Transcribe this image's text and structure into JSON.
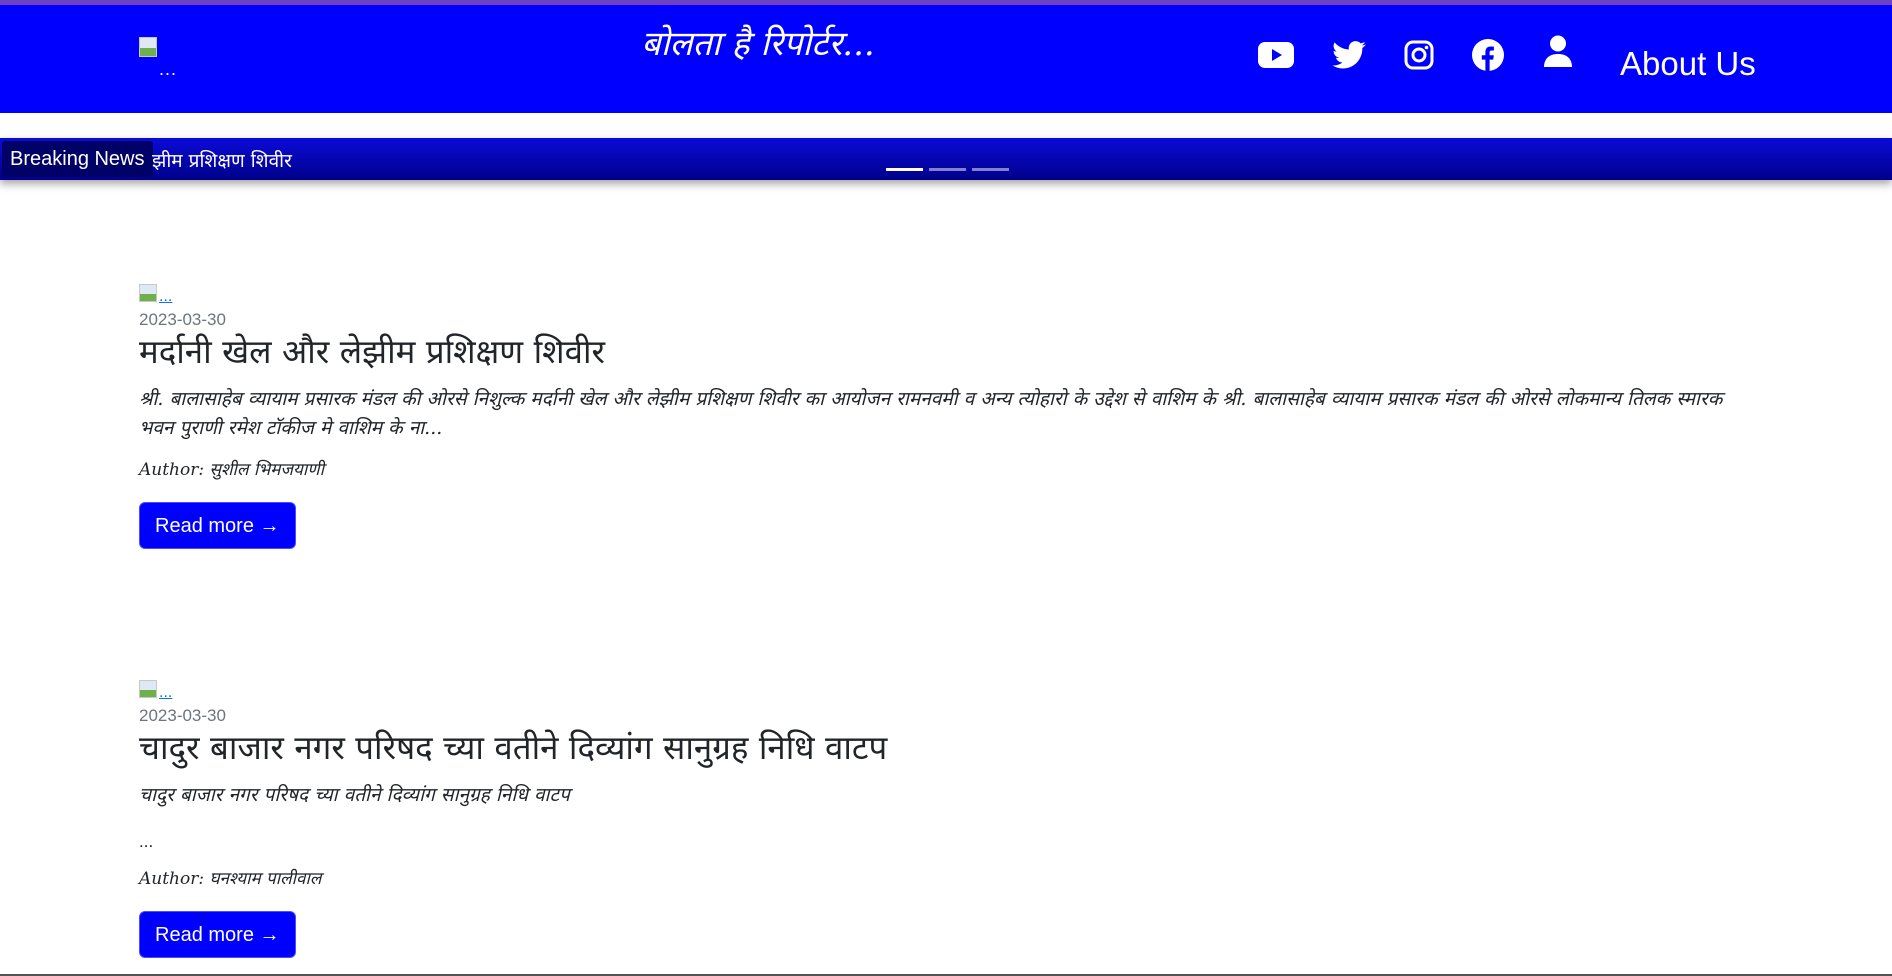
{
  "header": {
    "logo_alt": "...",
    "title": "बोलता है रिपोर्टर...",
    "about": "About Us"
  },
  "breaking": {
    "label": "Breaking News",
    "ticker": "झीम प्रशिक्षण शिवीर"
  },
  "articles": [
    {
      "image_alt": "...",
      "date": "2023-03-30",
      "title": "मर्दानी खेल और लेझीम प्रशिक्षण शिवीर",
      "excerpt": "श्री. बालासाहेब व्यायाम प्रसारक मंडल की ओरसे निशुल्क मर्दानी खेल और लेझीम प्रशिक्षण शिवीर का आयोजन रामनवमी व अन्य त्योहारो के उद्देश से वाशिम के श्री. बालासाहेब व्यायाम प्रसारक मंडल की ओरसे लोकमान्य तिलक स्मारक भवन पुराणी रमेश टॉकीज मे वाशिम के ना...",
      "author": "Author: सुशील भिमजयाणी",
      "button": "Read more →"
    },
    {
      "image_alt": "...",
      "date": "2023-03-30",
      "title": "चादुर बाजार नगर परिषद च्या वतीने दिव्यांग सानुग्रह निधि वाटप",
      "excerpt": "चादुर बाजार नगर परिषद च्या वतीने दिव्यांग सानुग्रह निधि वाटप",
      "extra": "...",
      "author": "Author: घनश्याम पालीवाल",
      "button": "Read more →"
    }
  ],
  "icons": [
    "youtube-icon",
    "twitter-icon",
    "instagram-icon",
    "facebook-icon",
    "user-icon"
  ],
  "colors": {
    "header": "#0000ff",
    "ticker": "#00008a",
    "button": "#0000ff"
  }
}
